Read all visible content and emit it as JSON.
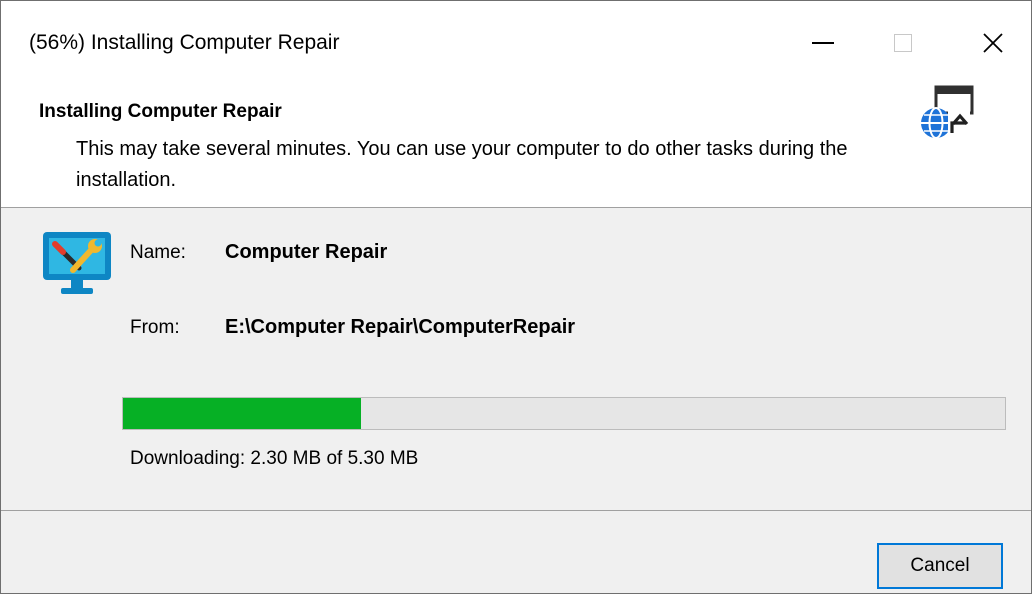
{
  "window": {
    "title": "(56%) Installing Computer Repair",
    "controls": [
      "minimize-icon",
      "maximize-icon",
      "close-icon"
    ]
  },
  "header": {
    "title": "Installing Computer Repair",
    "description": "This may take several minutes. You can use your computer to do other tasks during the installation.",
    "icon": "globe-install-icon"
  },
  "details": {
    "app_icon": "computer-repair-icon",
    "name_label": "Name:",
    "name_value": "Computer Repair",
    "from_label": "From:",
    "from_value": "E:\\Computer Repair\\ComputerRepair"
  },
  "progress": {
    "fraction": 0.27,
    "fill_color": "#06b025",
    "status": "Downloading: 2.30 MB of 5.30 MB"
  },
  "footer": {
    "cancel_label": "Cancel",
    "accent_color": "#0078d7"
  }
}
